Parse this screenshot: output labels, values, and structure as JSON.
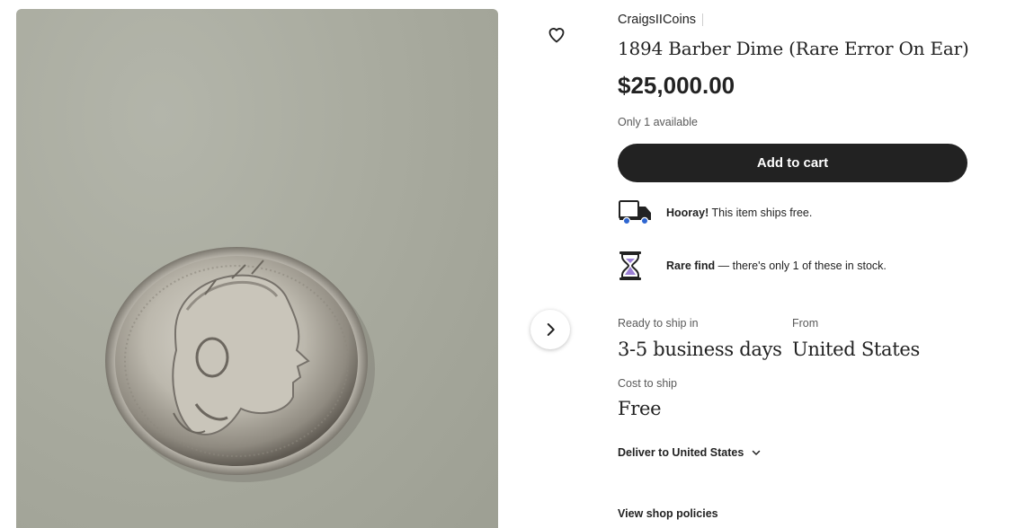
{
  "listing": {
    "shop_name": "CraigsIICoins",
    "title": "1894 Barber Dime (Rare Error On Ear)",
    "price": "$25,000.00",
    "availability": "Only 1 available",
    "add_to_cart_label": "Add to cart"
  },
  "perks": {
    "shipping": {
      "icon": "truck-icon",
      "bold": "Hooray!",
      "text": " This item ships free."
    },
    "rare": {
      "icon": "hourglass-icon",
      "bold": "Rare find",
      "text_before": " — there's only ",
      "count": "1",
      "text_after": " of these in stock."
    }
  },
  "shipping": {
    "ready_label": "Ready to ship in",
    "ready_value": "3-5 business days",
    "from_label": "From",
    "from_value": "United States",
    "cost_label": "Cost to ship",
    "cost_value": "Free",
    "deliver_to": "Deliver to United States"
  },
  "links": {
    "policies": "View shop policies"
  },
  "icons": {
    "favorite": "heart-outline-icon",
    "next_image": "chevron-right-icon",
    "deliver_dropdown": "chevron-down-icon"
  },
  "colors": {
    "button_bg": "#222222",
    "text": "#222222",
    "muted": "#595959",
    "truck_dot": "#2f66d1",
    "hourglass_sand": "#9b7fd4"
  }
}
